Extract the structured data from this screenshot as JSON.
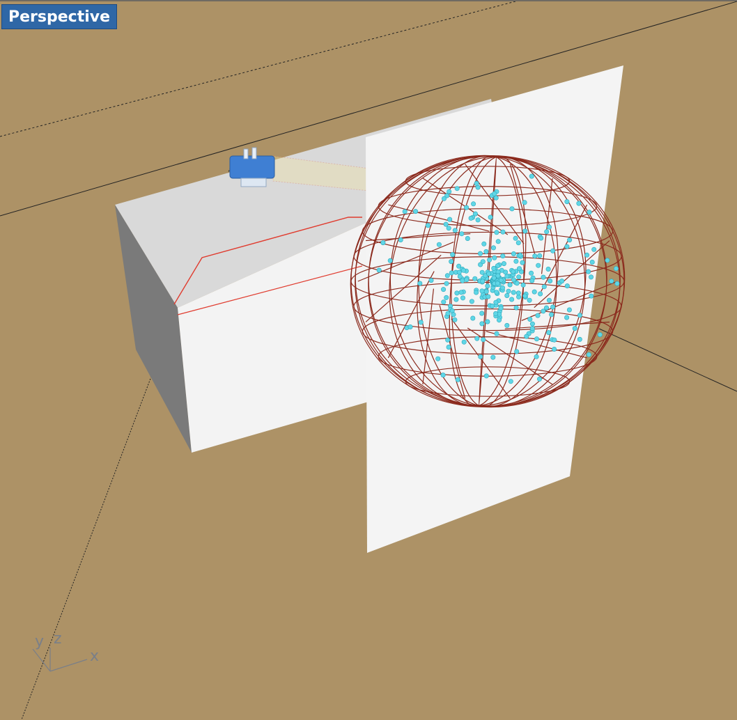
{
  "viewport": {
    "title": "Perspective",
    "background_color": "#ad9266",
    "tab_color": "#2f67a6"
  },
  "axes": {
    "x_label": "x",
    "y_label": "y",
    "z_label": "z"
  },
  "scene": {
    "box_top_color": "#d8d8d8",
    "box_side_color": "#f4f4f4",
    "box_dark_color": "#7b7b7b",
    "panel_color": "#f5f5f5",
    "sphere_wire_color": "#8b2a1d",
    "particle_color": "#5fd6e6",
    "curve_color": "#e03b2e",
    "camera_color": "#3f7fd3"
  }
}
